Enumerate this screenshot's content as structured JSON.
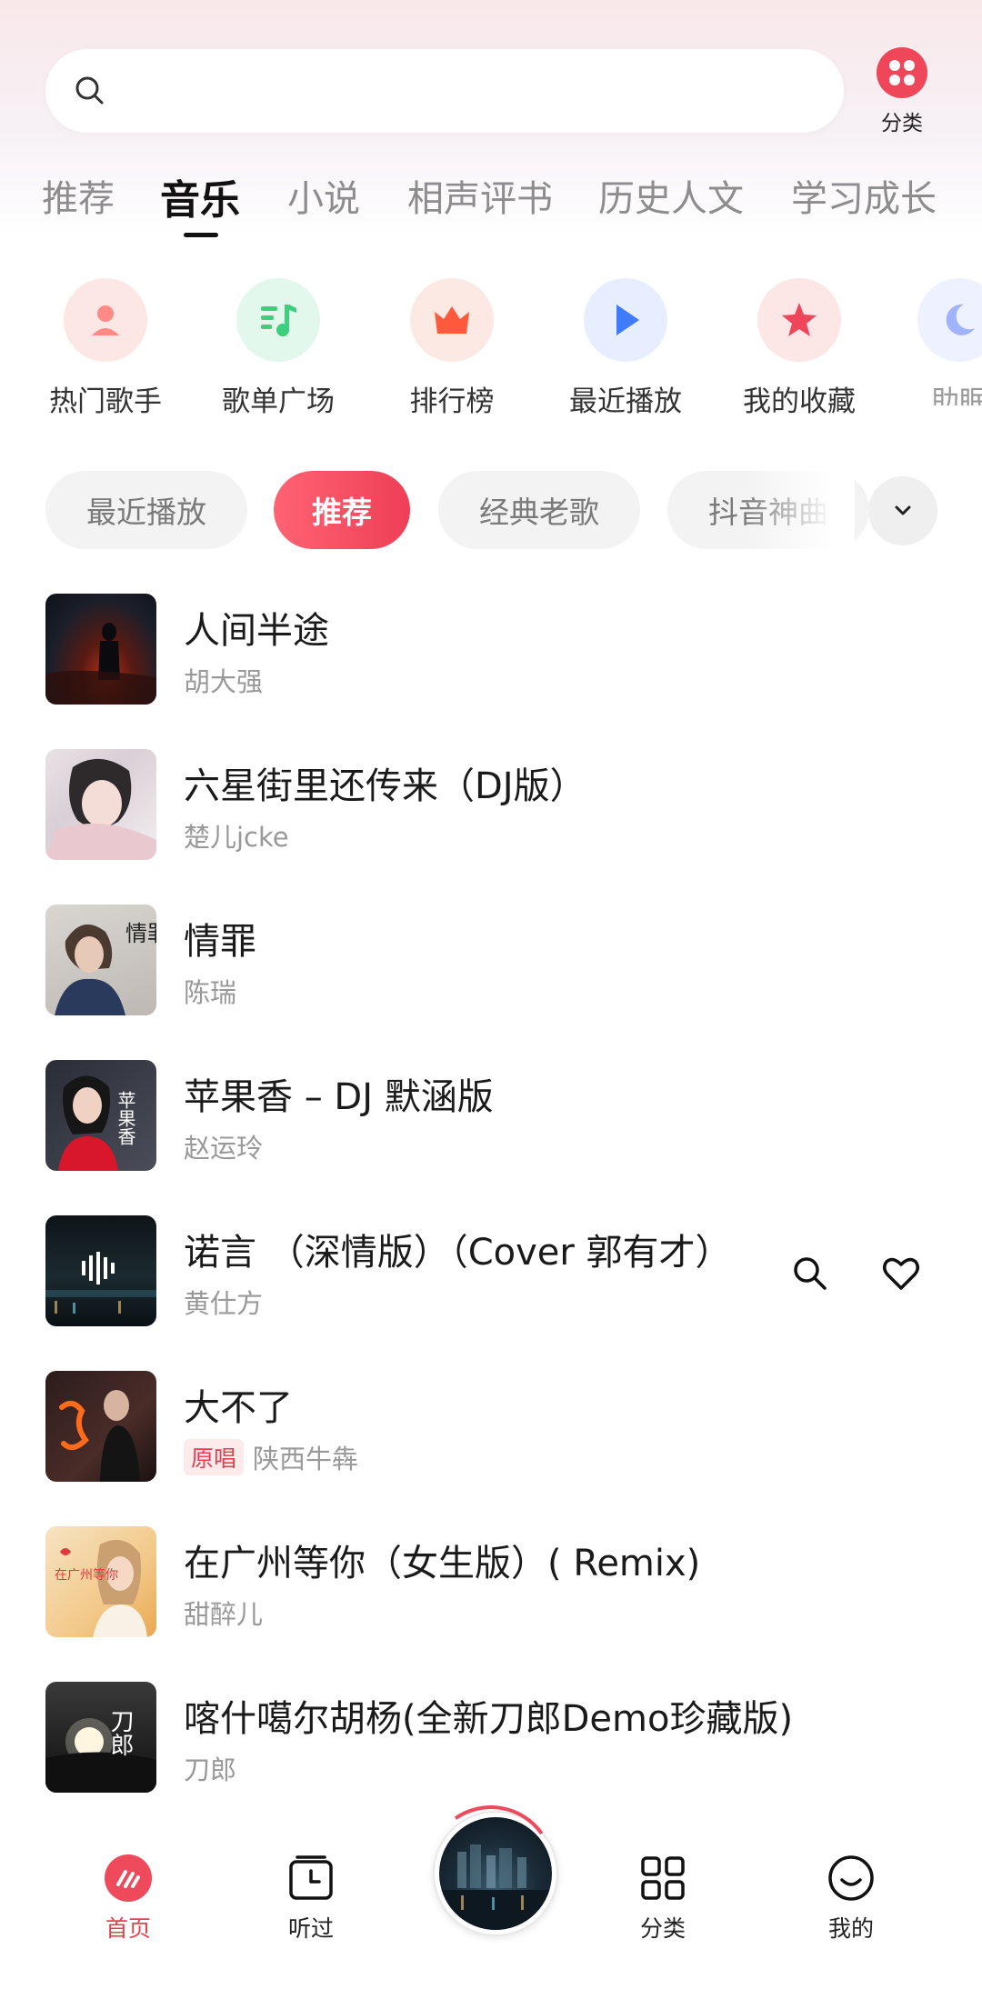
{
  "search": {
    "placeholder": ""
  },
  "category_button": {
    "label": "分类"
  },
  "tabs": [
    {
      "label": "推荐",
      "active": false
    },
    {
      "label": "音乐",
      "active": true
    },
    {
      "label": "小说",
      "active": false
    },
    {
      "label": "相声评书",
      "active": false
    },
    {
      "label": "历史人文",
      "active": false
    },
    {
      "label": "学习成长",
      "active": false
    }
  ],
  "quick_entries": [
    {
      "label": "热门歌手",
      "icon": "singer-icon",
      "color": "#ff8a86"
    },
    {
      "label": "歌单广场",
      "icon": "playlist-icon",
      "color": "#3ccf7e"
    },
    {
      "label": "排行榜",
      "icon": "crown-icon",
      "color": "#ff5a3c"
    },
    {
      "label": "最近播放",
      "icon": "play-icon",
      "color": "#3f7bff"
    },
    {
      "label": "我的收藏",
      "icon": "star-icon",
      "color": "#f0465a"
    },
    {
      "label": "助眠",
      "icon": "moon-icon",
      "color": "#9fb3ff"
    }
  ],
  "filter_chips": [
    {
      "label": "最近播放",
      "active": false
    },
    {
      "label": "推荐",
      "active": true
    },
    {
      "label": "经典老歌",
      "active": false
    },
    {
      "label": "抖音神曲",
      "active": false
    }
  ],
  "songs": [
    {
      "title": "人间半途",
      "artist": "胡大强",
      "badge": ""
    },
    {
      "title": "六星街里还传来（DJ版）",
      "artist": "楚儿jcke",
      "badge": ""
    },
    {
      "title": "情罪",
      "artist": "陈瑞",
      "badge": ""
    },
    {
      "title": "苹果香 – DJ 默涵版",
      "artist": "赵运玲",
      "badge": ""
    },
    {
      "title": " 诺言 （深情版）（Cover 郭有才）",
      "artist": "黄仕方",
      "badge": ""
    },
    {
      "title": "大不了",
      "artist": "陕西牛犇",
      "badge": "原唱"
    },
    {
      "title": "在广州等你（女生版）( Remix)",
      "artist": "甜醉儿",
      "badge": ""
    },
    {
      "title": "喀什噶尔胡杨(全新刀郎Demo珍藏版)",
      "artist": "刀郎",
      "badge": ""
    }
  ],
  "cover_text": {
    "qingzui": "情罪",
    "pingguoxiang": "苹果香",
    "guangzhou": "在广州等你",
    "daolang": "刀郎"
  },
  "bottom_nav": [
    {
      "label": "首页",
      "active": true,
      "icon": "home-icon"
    },
    {
      "label": "听过",
      "active": false,
      "icon": "history-icon"
    },
    {
      "label": "分类",
      "active": false,
      "icon": "grid-icon"
    },
    {
      "label": "我的",
      "active": false,
      "icon": "smile-icon"
    }
  ],
  "colors": {
    "accent": "#ef4a5c",
    "chip_bg": "#f3f3f3",
    "muted_text": "#999999"
  }
}
